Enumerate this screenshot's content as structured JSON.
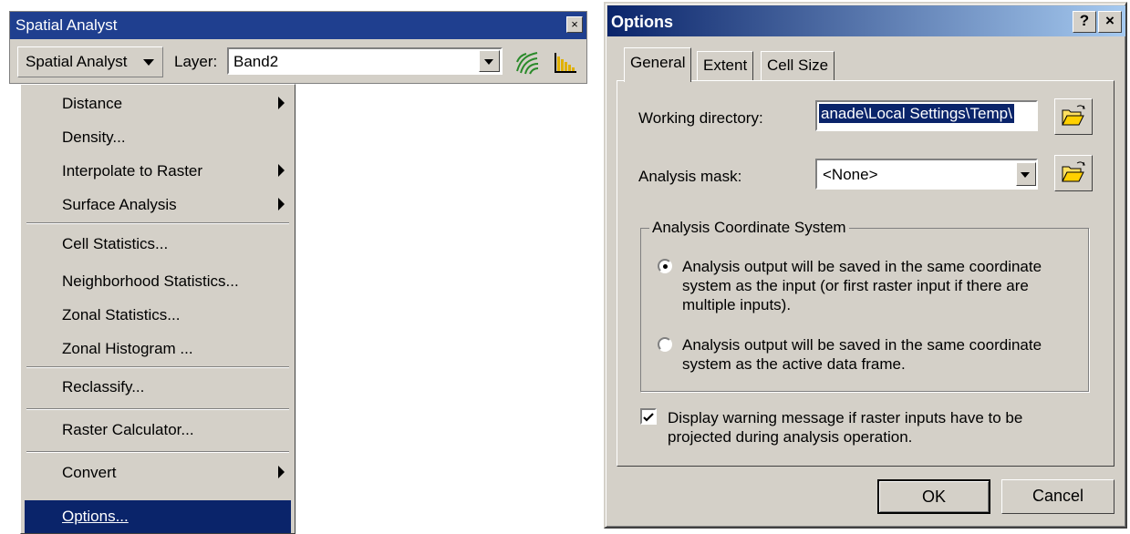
{
  "toolbar": {
    "title": "Spatial Analyst",
    "close_glyph": "×",
    "menu_button_label": "Spatial Analyst",
    "layer_label": "Layer:",
    "layer_value": "Band2",
    "icons": [
      "contour-icon",
      "histogram-icon"
    ]
  },
  "menu": {
    "items": [
      {
        "label": "Distance",
        "submenu": true
      },
      {
        "label": "Density...",
        "submenu": false
      },
      {
        "label": "Interpolate to Raster",
        "submenu": true
      },
      {
        "label": "Surface Analysis",
        "submenu": true
      },
      {
        "label": "Cell Statistics...",
        "submenu": false
      },
      {
        "label": "Neighborhood Statistics...",
        "submenu": false
      },
      {
        "label": "Zonal Statistics...",
        "submenu": false
      },
      {
        "label": "Zonal Histogram ...",
        "submenu": false
      },
      {
        "label": "Reclassify...",
        "submenu": false
      },
      {
        "label": "Raster Calculator...",
        "submenu": false
      },
      {
        "label": "Convert",
        "submenu": true
      },
      {
        "label": "Options...",
        "submenu": false,
        "highlighted": true
      }
    ]
  },
  "dialog": {
    "title": "Options",
    "help_glyph": "?",
    "close_glyph": "×",
    "tabs": [
      "General",
      "Extent",
      "Cell Size"
    ],
    "active_tab": "General",
    "working_directory_label": "Working directory:",
    "working_directory_value": "anade\\Local Settings\\Temp\\",
    "analysis_mask_label": "Analysis mask:",
    "analysis_mask_value": "<None>",
    "coord_group_title": "Analysis Coordinate System",
    "radio_input": "Analysis output will be saved in the same coordinate system as the input (or first raster input if there are multiple inputs).",
    "radio_input_lines": [
      "Analysis output will be saved in the same coordinate",
      "system as the input (or first raster input if there are",
      "multiple inputs)."
    ],
    "radio_frame_lines": [
      "Analysis output will be saved in the same coordinate",
      "system as the active data frame."
    ],
    "radio_selected": "input",
    "warning_checkbox_lines": [
      "Display warning message if raster inputs have to be",
      "projected during analysis operation."
    ],
    "warning_checked": true,
    "ok_label": "OK",
    "cancel_label": "Cancel"
  }
}
